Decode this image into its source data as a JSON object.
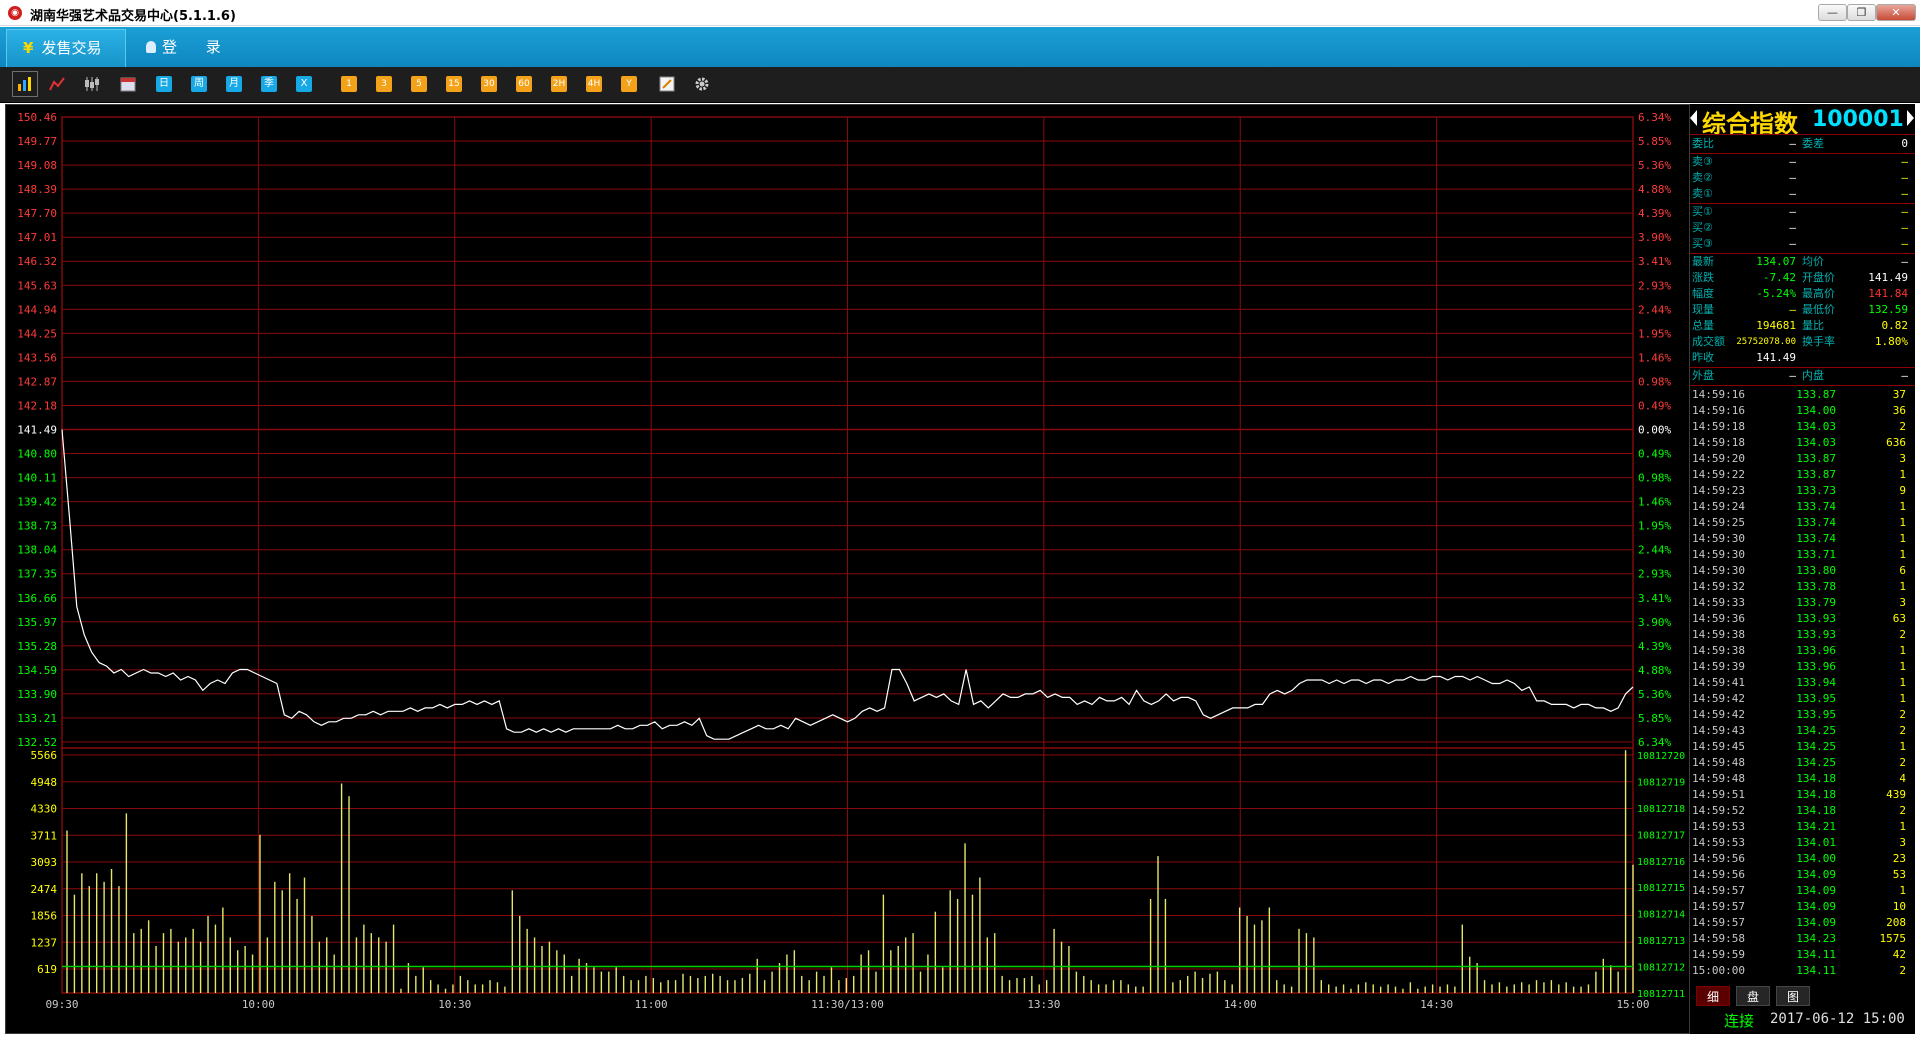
{
  "window": {
    "title": "湖南华强艺术品交易中心(5.1.1.6)",
    "min": "—",
    "max": "❐",
    "close": "✕"
  },
  "nav": {
    "sales": "发售交易",
    "login": "登 录"
  },
  "toolbar": {
    "blue_buttons": [
      "日",
      "周",
      "月",
      "季",
      "X"
    ],
    "orange_buttons": [
      "1",
      "3",
      "5",
      "15",
      "30",
      "60",
      "2H",
      "4H",
      "Y"
    ]
  },
  "side": {
    "name": "综合指数",
    "code": "100001",
    "ratio": {
      "label1": "委比",
      "value1": "—",
      "label2": "委差",
      "value2": "0"
    },
    "sells": [
      {
        "label": "卖③",
        "price": "—",
        "vol": "—"
      },
      {
        "label": "卖②",
        "price": "—",
        "vol": "—"
      },
      {
        "label": "卖①",
        "price": "—",
        "vol": "—"
      }
    ],
    "buys": [
      {
        "label": "买①",
        "price": "—",
        "vol": "—"
      },
      {
        "label": "买②",
        "price": "—",
        "vol": "—"
      },
      {
        "label": "买③",
        "price": "—",
        "vol": "—"
      }
    ],
    "quotes": [
      {
        "l1": "最新",
        "v1": "134.07",
        "c1": "#00ff00",
        "l2": "均价",
        "v2": "—",
        "c2": "#ffffff"
      },
      {
        "l1": "涨跌",
        "v1": "-7.42",
        "c1": "#00ff00",
        "l2": "开盘价",
        "v2": "141.49",
        "c2": "#ffffff"
      },
      {
        "l1": "幅度",
        "v1": "-5.24%",
        "c1": "#00ff00",
        "l2": "最高价",
        "v2": "141.84",
        "c2": "#ff3030"
      },
      {
        "l1": "现量",
        "v1": "—",
        "c1": "#ffff00",
        "l2": "最低价",
        "v2": "132.59",
        "c2": "#00ff00"
      },
      {
        "l1": "总量",
        "v1": "194681",
        "c1": "#ffff00",
        "l2": "量比",
        "v2": "0.82",
        "c2": "#ffff00"
      },
      {
        "l1": "成交额",
        "v1": "25752078.00",
        "c1": "#ffff00",
        "l2": "换手率",
        "v2": "1.80%",
        "c2": "#ffff00"
      },
      {
        "l1": "昨收",
        "v1": "141.49",
        "c1": "#ffffff",
        "l2": "",
        "v2": "",
        "c2": "#ffffff"
      }
    ],
    "outer": {
      "l1": "外盘",
      "v1": "—",
      "l2": "内盘",
      "v2": "—"
    },
    "ticks": [
      [
        "14:59:16",
        "133.87",
        "37"
      ],
      [
        "14:59:16",
        "134.00",
        "36"
      ],
      [
        "14:59:18",
        "134.03",
        "2"
      ],
      [
        "14:59:18",
        "134.03",
        "636"
      ],
      [
        "14:59:20",
        "133.87",
        "3"
      ],
      [
        "14:59:22",
        "133.87",
        "1"
      ],
      [
        "14:59:23",
        "133.73",
        "9"
      ],
      [
        "14:59:24",
        "133.74",
        "1"
      ],
      [
        "14:59:25",
        "133.74",
        "1"
      ],
      [
        "14:59:30",
        "133.74",
        "1"
      ],
      [
        "14:59:30",
        "133.71",
        "1"
      ],
      [
        "14:59:30",
        "133.80",
        "6"
      ],
      [
        "14:59:32",
        "133.78",
        "1"
      ],
      [
        "14:59:33",
        "133.79",
        "3"
      ],
      [
        "14:59:36",
        "133.93",
        "63"
      ],
      [
        "14:59:38",
        "133.93",
        "2"
      ],
      [
        "14:59:38",
        "133.96",
        "1"
      ],
      [
        "14:59:39",
        "133.96",
        "1"
      ],
      [
        "14:59:41",
        "133.94",
        "1"
      ],
      [
        "14:59:42",
        "133.95",
        "1"
      ],
      [
        "14:59:42",
        "133.95",
        "2"
      ],
      [
        "14:59:43",
        "134.25",
        "2"
      ],
      [
        "14:59:45",
        "134.25",
        "1"
      ],
      [
        "14:59:48",
        "134.25",
        "2"
      ],
      [
        "14:59:48",
        "134.18",
        "4"
      ],
      [
        "14:59:51",
        "134.18",
        "439"
      ],
      [
        "14:59:52",
        "134.18",
        "2"
      ],
      [
        "14:59:53",
        "134.21",
        "1"
      ],
      [
        "14:59:53",
        "134.01",
        "3"
      ],
      [
        "14:59:56",
        "134.00",
        "23"
      ],
      [
        "14:59:56",
        "134.09",
        "53"
      ],
      [
        "14:59:57",
        "134.09",
        "1"
      ],
      [
        "14:59:57",
        "134.09",
        "10"
      ],
      [
        "14:59:57",
        "134.09",
        "208"
      ],
      [
        "14:59:58",
        "134.23",
        "1575"
      ],
      [
        "14:59:59",
        "134.11",
        "42"
      ],
      [
        "15:00:00",
        "134.11",
        "2"
      ]
    ],
    "tabs": [
      "细",
      "盘",
      "图"
    ],
    "status": {
      "conn": "连接",
      "datetime": "2017-06-12 15:00"
    }
  },
  "chart_data": {
    "type": "line",
    "price_axis_left": [
      "150.46",
      "149.77",
      "149.08",
      "148.39",
      "147.70",
      "147.01",
      "146.32",
      "145.63",
      "144.94",
      "144.25",
      "143.56",
      "142.87",
      "142.18",
      "141.49",
      "140.80",
      "140.11",
      "139.42",
      "138.73",
      "138.04",
      "137.35",
      "136.66",
      "135.97",
      "135.28",
      "134.59",
      "133.90",
      "133.21",
      "132.52"
    ],
    "pct_axis_right": [
      "6.34%",
      "5.85%",
      "5.36%",
      "4.88%",
      "4.39%",
      "3.90%",
      "3.41%",
      "2.93%",
      "2.44%",
      "1.95%",
      "1.46%",
      "0.98%",
      "0.49%",
      "0.00%",
      "0.49%",
      "0.98%",
      "1.46%",
      "1.95%",
      "2.44%",
      "2.93%",
      "3.41%",
      "3.90%",
      "4.39%",
      "4.88%",
      "5.36%",
      "5.85%",
      "6.34%"
    ],
    "volume_axis_left": [
      "5566",
      "4948",
      "4330",
      "3711",
      "3093",
      "2474",
      "1856",
      "1237",
      "619"
    ],
    "volume_axis_right": [
      "10812720",
      "10812719",
      "10812718",
      "10812717",
      "10812716",
      "10812715",
      "10812714",
      "10812713",
      "10812712",
      "10812711"
    ],
    "time_labels": [
      "09:30",
      "10:00",
      "10:30",
      "11:00",
      "11:30/13:00",
      "13:30",
      "14:00",
      "14:30",
      "15:00"
    ],
    "ylim_price": [
      132.52,
      150.46
    ],
    "prev_close": 141.49,
    "ylim_volume": [
      0,
      5566
    ],
    "volume_avg_line": 619,
    "price": [
      141.49,
      139.0,
      136.4,
      135.6,
      135.1,
      134.8,
      134.7,
      134.5,
      134.6,
      134.4,
      134.5,
      134.6,
      134.5,
      134.5,
      134.4,
      134.5,
      134.3,
      134.4,
      134.3,
      134.0,
      134.2,
      134.3,
      134.2,
      134.5,
      134.6,
      134.6,
      134.5,
      134.4,
      134.3,
      134.2,
      133.3,
      133.2,
      133.4,
      133.3,
      133.1,
      133.0,
      133.1,
      133.1,
      133.2,
      133.2,
      133.3,
      133.3,
      133.4,
      133.3,
      133.4,
      133.4,
      133.4,
      133.5,
      133.4,
      133.5,
      133.5,
      133.6,
      133.5,
      133.6,
      133.6,
      133.7,
      133.6,
      133.7,
      133.6,
      133.7,
      132.9,
      132.8,
      132.8,
      132.9,
      132.8,
      132.9,
      132.8,
      132.9,
      132.8,
      132.9,
      132.9,
      132.9,
      132.9,
      132.9,
      132.9,
      133.0,
      132.9,
      132.9,
      133.0,
      133.0,
      133.1,
      132.9,
      133.0,
      133.0,
      133.1,
      133.0,
      133.2,
      132.7,
      132.6,
      132.6,
      132.6,
      132.7,
      132.8,
      132.9,
      133.0,
      132.9,
      132.9,
      133.0,
      132.9,
      133.2,
      133.1,
      133.0,
      133.1,
      133.2,
      133.3,
      133.2,
      133.1,
      133.2,
      133.4,
      133.5,
      133.4,
      133.5,
      134.6,
      134.6,
      134.2,
      133.7,
      133.8,
      133.9,
      133.8,
      133.9,
      133.7,
      133.6,
      134.6,
      133.6,
      133.7,
      133.5,
      133.7,
      133.9,
      133.8,
      133.8,
      133.9,
      133.9,
      134.0,
      133.8,
      133.9,
      133.8,
      133.8,
      133.6,
      133.7,
      133.6,
      133.8,
      133.7,
      133.7,
      133.8,
      133.6,
      134.0,
      133.7,
      133.6,
      133.7,
      133.9,
      133.7,
      133.8,
      133.8,
      133.7,
      133.3,
      133.2,
      133.3,
      133.4,
      133.5,
      133.5,
      133.5,
      133.6,
      133.6,
      133.9,
      134.0,
      133.9,
      134.0,
      134.2,
      134.3,
      134.3,
      134.3,
      134.2,
      134.3,
      134.2,
      134.3,
      134.3,
      134.2,
      134.3,
      134.3,
      134.2,
      134.3,
      134.3,
      134.4,
      134.3,
      134.3,
      134.4,
      134.4,
      134.3,
      134.4,
      134.4,
      134.3,
      134.4,
      134.3,
      134.2,
      134.2,
      134.3,
      134.2,
      134.0,
      134.1,
      133.7,
      133.7,
      133.6,
      133.6,
      133.6,
      133.5,
      133.6,
      133.6,
      133.5,
      133.5,
      133.4,
      133.5,
      133.9,
      134.1
    ],
    "volume": [
      3800,
      2300,
      2800,
      2500,
      2800,
      2600,
      2900,
      2500,
      4200,
      1400,
      1500,
      1700,
      1100,
      1400,
      1500,
      1200,
      1300,
      1500,
      1200,
      1800,
      1600,
      2000,
      1300,
      1000,
      1100,
      900,
      3700,
      1300,
      2600,
      2400,
      2800,
      2200,
      2700,
      1800,
      1200,
      1300,
      900,
      4900,
      4600,
      1300,
      1600,
      1400,
      1300,
      1200,
      1600,
      100,
      700,
      400,
      600,
      300,
      200,
      100,
      200,
      400,
      300,
      200,
      200,
      300,
      250,
      150,
      2400,
      1800,
      1500,
      1300,
      1100,
      1200,
      1000,
      900,
      400,
      800,
      700,
      600,
      500,
      500,
      600,
      400,
      300,
      300,
      400,
      350,
      250,
      300,
      300,
      450,
      400,
      350,
      400,
      450,
      400,
      300,
      300,
      350,
      450,
      800,
      300,
      500,
      700,
      900,
      1000,
      400,
      300,
      500,
      400,
      600,
      300,
      350,
      400,
      900,
      1000,
      500,
      2300,
      1000,
      1100,
      1300,
      1400,
      500,
      900,
      1900,
      600,
      2400,
      2200,
      3500,
      2300,
      2700,
      1300,
      1400,
      400,
      300,
      350,
      350,
      400,
      200,
      300,
      1500,
      1200,
      1100,
      500,
      400,
      300,
      200,
      200,
      300,
      300,
      200,
      150,
      150,
      2200,
      3200,
      2200,
      250,
      300,
      400,
      500,
      350,
      450,
      500,
      300,
      200,
      2000,
      1800,
      1600,
      1700,
      2000,
      300,
      200,
      150,
      1500,
      1400,
      1300,
      300,
      200,
      150,
      200,
      100,
      200,
      250,
      200,
      150,
      200,
      150,
      100,
      250,
      100,
      150,
      200,
      150,
      200,
      150,
      1600,
      850,
      700,
      300,
      200,
      250,
      150,
      200,
      250,
      200,
      300,
      250,
      300,
      200,
      250,
      150,
      150,
      200,
      500,
      800,
      650,
      500,
      6200,
      3000
    ]
  }
}
